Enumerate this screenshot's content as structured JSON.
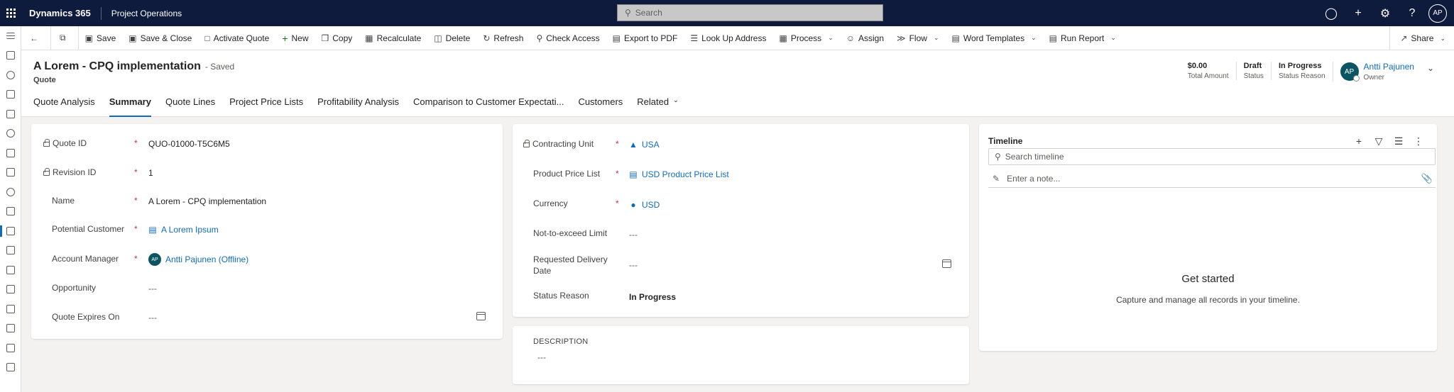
{
  "topbar": {
    "brand": "Dynamics 365",
    "app_name": "Project Operations",
    "search_placeholder": "Search",
    "avatar_initials": "AP"
  },
  "commands": [
    {
      "label": "Save",
      "icon": "save-icon"
    },
    {
      "label": "Save & Close",
      "icon": "save-close-icon"
    },
    {
      "label": "Activate Quote",
      "icon": "activate-icon"
    },
    {
      "label": "New",
      "icon": "plus-icon"
    },
    {
      "label": "Copy",
      "icon": "copy-icon"
    },
    {
      "label": "Recalculate",
      "icon": "calculator-icon"
    },
    {
      "label": "Delete",
      "icon": "trash-icon"
    },
    {
      "label": "Refresh",
      "icon": "refresh-icon"
    },
    {
      "label": "Check Access",
      "icon": "search-icon"
    },
    {
      "label": "Export to PDF",
      "icon": "pdf-icon"
    },
    {
      "label": "Look Up Address",
      "icon": "address-icon"
    },
    {
      "label": "Process",
      "icon": "process-icon"
    },
    {
      "label": "Assign",
      "icon": "assign-icon"
    },
    {
      "label": "Flow",
      "icon": "flow-icon"
    },
    {
      "label": "Word Templates",
      "icon": "word-icon"
    },
    {
      "label": "Run Report",
      "icon": "report-icon"
    }
  ],
  "share_label": "Share",
  "header": {
    "title": "A Lorem - CPQ implementation",
    "saved": "- Saved",
    "entity": "Quote",
    "total_amount_value": "$0.00",
    "total_amount_label": "Total Amount",
    "status_value": "Draft",
    "status_label": "Status",
    "status_reason_value": "In Progress",
    "status_reason_label": "Status Reason",
    "owner_initials": "AP",
    "owner_value": "Antti Pajunen",
    "owner_label": "Owner"
  },
  "tabs": [
    {
      "label": "Quote Analysis"
    },
    {
      "label": "Summary"
    },
    {
      "label": "Quote Lines"
    },
    {
      "label": "Project Price Lists"
    },
    {
      "label": "Profitability Analysis"
    },
    {
      "label": "Comparison to Customer Expectati..."
    },
    {
      "label": "Customers"
    },
    {
      "label": "Related"
    }
  ],
  "left_fields": {
    "quote_id": {
      "label": "Quote ID",
      "value": "QUO-01000-T5C6M5"
    },
    "revision_id": {
      "label": "Revision ID",
      "value": "1"
    },
    "name": {
      "label": "Name",
      "value": "A Lorem - CPQ implementation"
    },
    "potential_customer": {
      "label": "Potential Customer",
      "value": "A Lorem Ipsum"
    },
    "account_manager": {
      "label": "Account Manager",
      "value": "Antti Pajunen (Offline)",
      "initials": "AP"
    },
    "opportunity": {
      "label": "Opportunity",
      "value": "---"
    },
    "quote_expires": {
      "label": "Quote Expires On",
      "value": "---"
    }
  },
  "middle_fields": {
    "contracting_unit": {
      "label": "Contracting Unit",
      "value": "USA"
    },
    "price_list": {
      "label": "Product Price List",
      "value": "USD Product Price List"
    },
    "currency": {
      "label": "Currency",
      "value": "USD"
    },
    "nte_limit": {
      "label": "Not-to-exceed Limit",
      "value": "---"
    },
    "delivery_date": {
      "label1": "Requested Delivery",
      "label2": "Date",
      "value": "---"
    },
    "status_reason": {
      "label": "Status Reason",
      "value": "In Progress"
    }
  },
  "description": {
    "label": "DESCRIPTION",
    "value": "---"
  },
  "required_marker": "*",
  "timeline": {
    "title": "Timeline",
    "search_placeholder": "Search timeline",
    "note_placeholder": "Enter a note...",
    "empty_heading": "Get started",
    "empty_text": "Capture and manage all records in your timeline."
  }
}
